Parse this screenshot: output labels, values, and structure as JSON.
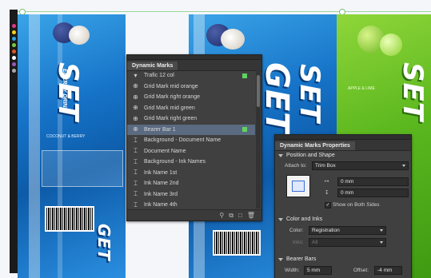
{
  "artwork": {
    "can_word": "SET",
    "can_word_2": "GET",
    "energy_label": "ENERGY DRINK",
    "flavor_left": "COCONUT & BERRY",
    "flavor_right": "APPLE & LIME",
    "volume": "500 ml"
  },
  "dynamic_marks": {
    "title": "Dynamic Marks",
    "items": [
      {
        "icon": "chevron-down-icon",
        "label": "Trafic 12 col",
        "checked": true
      },
      {
        "icon": "crosshair-icon",
        "label": "Grid Mark mid orange",
        "checked": false
      },
      {
        "icon": "crosshair-icon",
        "label": "Grid Mark right orange",
        "checked": false
      },
      {
        "icon": "crosshair-icon",
        "label": "Grid Mark mid green",
        "checked": false
      },
      {
        "icon": "crosshair-icon",
        "label": "Grid Mark right green",
        "checked": false
      },
      {
        "icon": "crosshair-icon",
        "label": "Bearer Bar 1",
        "checked": true,
        "selected": true
      },
      {
        "icon": "text-block-icon",
        "label": "Background - Document Name",
        "checked": false
      },
      {
        "icon": "text-icon",
        "label": "Document Name",
        "checked": false
      },
      {
        "icon": "text-block-icon",
        "label": "Background - Ink Names",
        "checked": false
      },
      {
        "icon": "text-icon",
        "label": "Ink Name 1st",
        "checked": false
      },
      {
        "icon": "text-icon",
        "label": "Ink Name 2nd",
        "checked": false
      },
      {
        "icon": "text-icon",
        "label": "Ink Name 3rd",
        "checked": false
      },
      {
        "icon": "text-icon",
        "label": "Ink Name 4th",
        "checked": false
      }
    ],
    "footer_icons": [
      "search-icon",
      "duplicate-icon",
      "new-mark-icon",
      "delete-icon"
    ]
  },
  "properties": {
    "title": "Dynamic Marks Properties",
    "position_section": "Position and Shape",
    "attach_label": "Attach to:",
    "attach_value": "Trim Box",
    "h_offset": "0 mm",
    "v_offset": "0 mm",
    "show_both_sides": "Show on Both Sides",
    "color_section": "Color and Inks",
    "color_label": "Color:",
    "color_value": "Registration",
    "inks_label": "Inks:",
    "inks_value": "All",
    "bearer_section": "Bearer Bars",
    "width_label": "Width:",
    "width_value": "5 mm",
    "offset_label": "Offset:",
    "offset_value": "-4 mm"
  }
}
